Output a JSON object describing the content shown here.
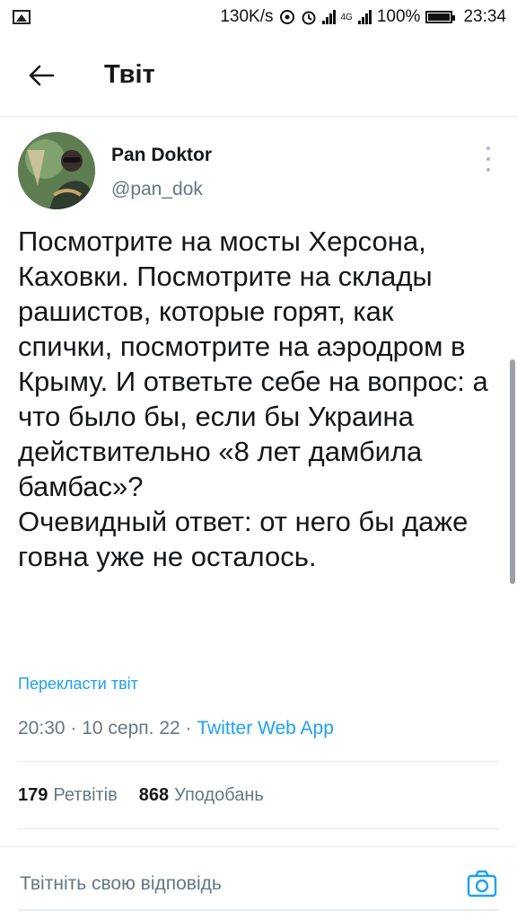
{
  "status_bar": {
    "speed": "130K/s",
    "battery": "100%",
    "time": "23:34",
    "network": "4G"
  },
  "header": {
    "back_icon": "arrow-left-icon",
    "title": "Твіт"
  },
  "tweet": {
    "author_name": "Pan Doktor",
    "author_handle": "@pan_dok",
    "text": "Посмотрите на мосты Херсона, Каховки. Посмотрите на склады рашистов, которые горят, как спички, посмотрите на аэродром в Крыму. И ответьте себе на вопрос: а что было бы, если бы Украина действительно «8 лет дамбила бамбас»?\nОчевидный ответ: от него бы даже говна уже не осталось.",
    "translate_link": "Перекласти твіт",
    "time": "20:30",
    "date": "10 серп. 22",
    "source": "Twitter Web App",
    "retweets_count": "179",
    "retweets_label": "Ретвітів",
    "likes_count": "868",
    "likes_label": "Уподобань"
  },
  "reply": {
    "placeholder": "Твітніть свою відповідь",
    "camera_icon": "camera-icon"
  },
  "colors": {
    "accent": "#1da1f2",
    "secondary_text": "#657786",
    "divider": "#e6ecf0"
  }
}
